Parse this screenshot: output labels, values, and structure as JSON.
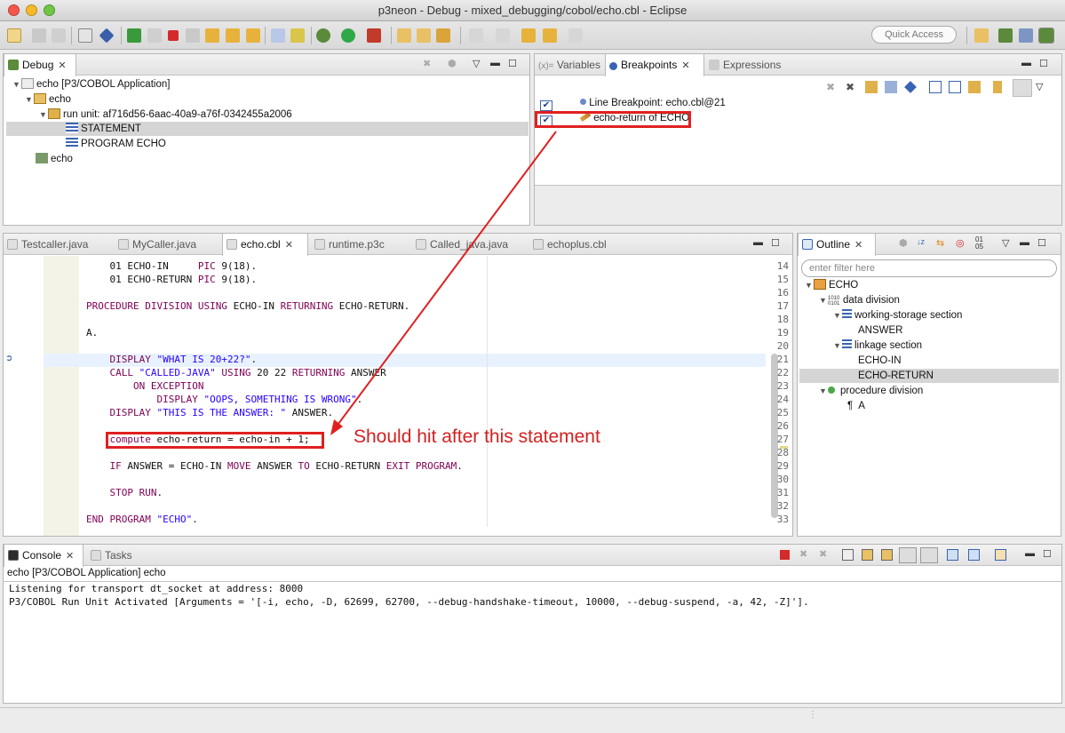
{
  "window": {
    "title": "p3neon - Debug - mixed_debugging/cobol/echo.cbl - Eclipse"
  },
  "toolbar": {
    "quick_access": "Quick Access"
  },
  "debug_view": {
    "tab": "Debug",
    "tree": [
      {
        "label": "echo [P3/COBOL Application]",
        "level": 0,
        "expanded": true,
        "icon": "launch-icon"
      },
      {
        "label": "echo",
        "level": 1,
        "expanded": true,
        "icon": "process-icon"
      },
      {
        "label": "run unit: af716d56-6aac-40a9-a76f-0342455a2006",
        "level": 2,
        "expanded": true,
        "icon": "thread-icon"
      },
      {
        "label": "STATEMENT",
        "level": 3,
        "expanded": false,
        "icon": "stack-frame-icon",
        "selected": true
      },
      {
        "label": "PROGRAM ECHO",
        "level": 3,
        "expanded": false,
        "icon": "stack-frame-icon"
      },
      {
        "label": "echo",
        "level": 1,
        "expanded": false,
        "icon": "debug-target-icon"
      }
    ]
  },
  "breakpoints_view": {
    "tabs": [
      "Variables",
      "Breakpoints",
      "Expressions"
    ],
    "tab_prefix": "(x)=",
    "active_tab": "Breakpoints",
    "items": [
      {
        "label": "Line Breakpoint: echo.cbl@21",
        "checked": true
      },
      {
        "label": "echo-return of ECHO",
        "checked": true
      }
    ]
  },
  "editor": {
    "tabs": [
      "Testcaller.java",
      "MyCaller.java",
      "echo.cbl",
      "runtime.p3c",
      "Called_java.java",
      "echoplus.cbl"
    ],
    "active_tab": "echo.cbl",
    "lines": [
      {
        "n": "14",
        "text": "    01 ECHO-IN     PIC 9(18)."
      },
      {
        "n": "15",
        "text": "    01 ECHO-RETURN PIC 9(18)."
      },
      {
        "n": "16",
        "text": ""
      },
      {
        "n": "17",
        "text": "PROCEDURE DIVISION USING ECHO-IN RETURNING ECHO-RETURN."
      },
      {
        "n": "18",
        "text": ""
      },
      {
        "n": "19",
        "text": "A."
      },
      {
        "n": "20",
        "text": ""
      },
      {
        "n": "21",
        "text": "    DISPLAY \"WHAT IS 20+22?\"."
      },
      {
        "n": "22",
        "text": "    CALL \"CALLED-JAVA\" USING 20 22 RETURNING ANSWER"
      },
      {
        "n": "23",
        "text": "        ON EXCEPTION"
      },
      {
        "n": "24",
        "text": "            DISPLAY \"OOPS, SOMETHING IS WRONG\"."
      },
      {
        "n": "25",
        "text": "    DISPLAY \"THIS IS THE ANSWER: \" ANSWER."
      },
      {
        "n": "26",
        "text": ""
      },
      {
        "n": "27",
        "text": "    compute echo-return = echo-in + 1;"
      },
      {
        "n": "28",
        "text": ""
      },
      {
        "n": "29",
        "text": "    IF ANSWER = ECHO-IN MOVE ANSWER TO ECHO-RETURN EXIT PROGRAM."
      },
      {
        "n": "30",
        "text": ""
      },
      {
        "n": "31",
        "text": "    STOP RUN."
      },
      {
        "n": "32",
        "text": ""
      },
      {
        "n": "33",
        "text": "END PROGRAM \"ECHO\"."
      }
    ],
    "current_line": "21"
  },
  "outline": {
    "tab": "Outline",
    "filter_placeholder": "enter filter here",
    "tree": [
      {
        "label": "ECHO",
        "level": 0
      },
      {
        "label": "data division",
        "level": 1
      },
      {
        "label": "working-storage section",
        "level": 2
      },
      {
        "label": "ANSWER",
        "level": 3
      },
      {
        "label": "linkage section",
        "level": 2
      },
      {
        "label": "ECHO-IN",
        "level": 3
      },
      {
        "label": "ECHO-RETURN",
        "level": 3,
        "selected": true
      },
      {
        "label": "procedure division",
        "level": 1
      },
      {
        "label": "A",
        "level": 2
      }
    ],
    "sort_label_top": "01",
    "sort_label_bottom": "05"
  },
  "console": {
    "tabs": [
      "Console",
      "Tasks"
    ],
    "header": "echo [P3/COBOL Application] echo",
    "lines": [
      "Listening for transport dt_socket at address: 8000",
      "P3/COBOL Run Unit Activated [Arguments = '[-i, echo, -D, 62699, 62700, --debug-handshake-timeout, 10000, --debug-suspend, -a, 42, -Z]']."
    ]
  },
  "annotation": {
    "text": "Should hit after this statement",
    "color": "#d42020"
  }
}
